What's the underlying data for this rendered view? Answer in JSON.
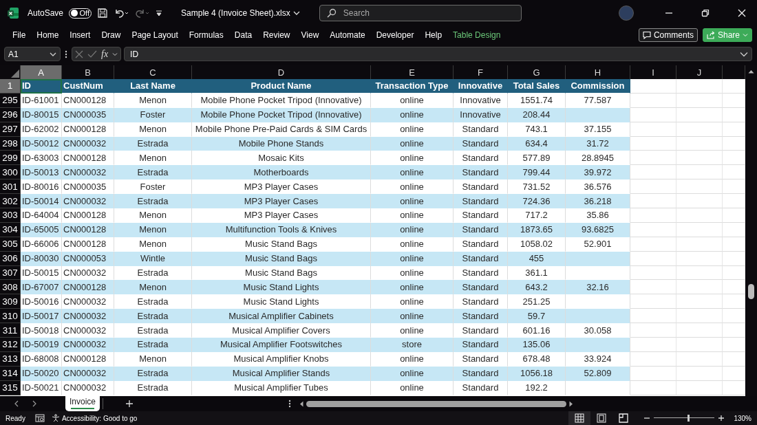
{
  "app": {
    "autosave_label": "AutoSave",
    "autosave_on": false,
    "autosave_state": "Off",
    "file_name": "Sample 4 (Invoice Sheet).xlsx",
    "search_placeholder": "Search"
  },
  "menu": [
    {
      "label": "File",
      "kind": "tab"
    },
    {
      "label": "Home",
      "kind": "tab"
    },
    {
      "label": "Insert",
      "kind": "tab"
    },
    {
      "label": "Draw",
      "kind": "tab"
    },
    {
      "label": "Page Layout",
      "kind": "tab"
    },
    {
      "label": "Formulas",
      "kind": "tab"
    },
    {
      "label": "Data",
      "kind": "tab"
    },
    {
      "label": "Review",
      "kind": "tab"
    },
    {
      "label": "View",
      "kind": "tab"
    },
    {
      "label": "Automate",
      "kind": "tab"
    },
    {
      "label": "Developer",
      "kind": "tab"
    },
    {
      "label": "Help",
      "kind": "tab"
    },
    {
      "label": "Table Design",
      "kind": "contextual"
    }
  ],
  "buttons": {
    "comments": "Comments",
    "share": "Share"
  },
  "formula_bar": {
    "name_box": "A1",
    "function_label": "fx",
    "formula": "ID"
  },
  "columns": [
    {
      "letter": "A",
      "selected": true
    },
    {
      "letter": "B",
      "selected": false
    },
    {
      "letter": "C",
      "selected": false
    },
    {
      "letter": "D",
      "selected": false
    },
    {
      "letter": "E",
      "selected": false
    },
    {
      "letter": "F",
      "selected": false
    },
    {
      "letter": "G",
      "selected": false
    },
    {
      "letter": "H",
      "selected": false
    },
    {
      "letter": "I",
      "selected": false
    },
    {
      "letter": "J",
      "selected": false
    }
  ],
  "rows": [
    {
      "number": "1",
      "kind": "header",
      "selected": true,
      "cells": [
        "ID",
        "CustNum",
        "Last Name",
        "Product Name",
        "Transaction Type",
        "Innovative",
        "Total Sales",
        "Commission"
      ]
    },
    {
      "number": "295",
      "kind": "data",
      "selected": false,
      "cells": [
        "ID-61001",
        "CN000128",
        "Menon",
        "Mobile Phone Pocket Tripod (Innovative)",
        "online",
        "Innovative",
        "1551.74",
        "77.587"
      ]
    },
    {
      "number": "296",
      "kind": "data",
      "selected": false,
      "cells": [
        "ID-80015",
        "CN000035",
        "Foster",
        "Mobile Phone Pocket Tripod (Innovative)",
        "online",
        "Innovative",
        "208.44"
      ]
    },
    {
      "number": "297",
      "kind": "data",
      "selected": false,
      "cells": [
        "ID-62002",
        "CN000128",
        "Menon",
        "Mobile Phone Pre-Paid Cards & SIM Cards",
        "online",
        "Standard",
        "743.1",
        "37.155"
      ]
    },
    {
      "number": "298",
      "kind": "data",
      "selected": false,
      "cells": [
        "ID-50012",
        "CN000032",
        "Estrada",
        "Mobile Phone Stands",
        "online",
        "Standard",
        "634.4",
        "31.72"
      ]
    },
    {
      "number": "299",
      "kind": "data",
      "selected": false,
      "cells": [
        "ID-63003",
        "CN000128",
        "Menon",
        "Mosaic Kits",
        "online",
        "Standard",
        "577.89",
        "28.8945"
      ]
    },
    {
      "number": "300",
      "kind": "data",
      "selected": false,
      "cells": [
        "ID-50013",
        "CN000032",
        "Estrada",
        "Motherboards",
        "online",
        "Standard",
        "799.44",
        "39.972"
      ]
    },
    {
      "number": "301",
      "kind": "data",
      "selected": false,
      "cells": [
        "ID-80016",
        "CN000035",
        "Foster",
        "MP3 Player Cases",
        "online",
        "Standard",
        "731.52",
        "36.576"
      ]
    },
    {
      "number": "302",
      "kind": "data",
      "selected": false,
      "cells": [
        "ID-50014",
        "CN000032",
        "Estrada",
        "MP3 Player Cases",
        "online",
        "Standard",
        "724.36",
        "36.218"
      ]
    },
    {
      "number": "303",
      "kind": "data",
      "selected": false,
      "cells": [
        "ID-64004",
        "CN000128",
        "Menon",
        "MP3 Player Cases",
        "online",
        "Standard",
        "717.2",
        "35.86"
      ]
    },
    {
      "number": "304",
      "kind": "data",
      "selected": false,
      "cells": [
        "ID-65005",
        "CN000128",
        "Menon",
        "Multifunction Tools & Knives",
        "online",
        "Standard",
        "1873.65",
        "93.6825"
      ]
    },
    {
      "number": "305",
      "kind": "data",
      "selected": false,
      "cells": [
        "ID-66006",
        "CN000128",
        "Menon",
        "Music Stand Bags",
        "online",
        "Standard",
        "1058.02",
        "52.901"
      ]
    },
    {
      "number": "306",
      "kind": "data",
      "selected": false,
      "cells": [
        "ID-80030",
        "CN000053",
        "Wintle",
        "Music Stand Bags",
        "online",
        "Standard",
        "455"
      ]
    },
    {
      "number": "307",
      "kind": "data",
      "selected": false,
      "cells": [
        "ID-50015",
        "CN000032",
        "Estrada",
        "Music Stand Bags",
        "online",
        "Standard",
        "361.1"
      ]
    },
    {
      "number": "308",
      "kind": "data",
      "selected": false,
      "cells": [
        "ID-67007",
        "CN000128",
        "Menon",
        "Music Stand Lights",
        "online",
        "Standard",
        "643.2",
        "32.16"
      ]
    },
    {
      "number": "309",
      "kind": "data",
      "selected": false,
      "cells": [
        "ID-50016",
        "CN000032",
        "Estrada",
        "Music Stand Lights",
        "online",
        "Standard",
        "251.25"
      ]
    },
    {
      "number": "310",
      "kind": "data",
      "selected": false,
      "cells": [
        "ID-50017",
        "CN000032",
        "Estrada",
        "Musical Amplifier Cabinets",
        "online",
        "Standard",
        "59.7"
      ]
    },
    {
      "number": "311",
      "kind": "data",
      "selected": false,
      "cells": [
        "ID-50018",
        "CN000032",
        "Estrada",
        "Musical Amplifier Covers",
        "online",
        "Standard",
        "601.16",
        "30.058"
      ]
    },
    {
      "number": "312",
      "kind": "data",
      "selected": false,
      "cells": [
        "ID-50019",
        "CN000032",
        "Estrada",
        "Musical Amplifier Footswitches",
        "store",
        "Standard",
        "135.06"
      ]
    },
    {
      "number": "313",
      "kind": "data",
      "selected": false,
      "cells": [
        "ID-68008",
        "CN000128",
        "Menon",
        "Musical Amplifier Knobs",
        "online",
        "Standard",
        "678.48",
        "33.924"
      ]
    },
    {
      "number": "314",
      "kind": "data",
      "selected": false,
      "cells": [
        "ID-50020",
        "CN000032",
        "Estrada",
        "Musical Amplifier Stands",
        "online",
        "Standard",
        "1056.18",
        "52.809"
      ]
    },
    {
      "number": "315",
      "kind": "data",
      "selected": false,
      "cells": [
        "ID-50021",
        "CN000032",
        "Estrada",
        "Musical Amplifier Tubes",
        "online",
        "Standard",
        "192.2"
      ]
    }
  ],
  "sheet_tabs": [
    {
      "label": "Invoice",
      "selected": true
    }
  ],
  "status": {
    "ready": "Ready",
    "accessibility": "Accessibility: Good to go",
    "zoom": "130%"
  },
  "views": [
    {
      "kind": "normal",
      "selected": true
    },
    {
      "kind": "page_layout",
      "selected": false
    },
    {
      "kind": "page_break",
      "selected": false
    }
  ],
  "zoom_slider": {
    "level": 0.56
  }
}
